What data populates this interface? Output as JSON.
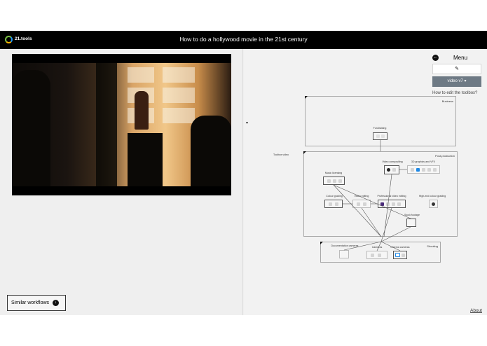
{
  "header": {
    "brand": "21.tools",
    "title": "How to do a hollywood movie in the 21st century"
  },
  "left": {
    "similar_label": "Similar workflows"
  },
  "menu": {
    "label": "Menu",
    "version_label": "video v7 ▾",
    "help_link": "How to edit the toolbox?"
  },
  "diagram": {
    "business_label": "Business",
    "fundraising_label": "Fundraising",
    "toolbox_label": "Toolbox video",
    "postproduction_label": "Post-production",
    "shooting_label": "Shooting",
    "tools": {
      "music_licensing": "Music licensing",
      "video_compositing": "Video compositing",
      "graphics_vfx": "3D graphics and VFX",
      "colour_grading": "Colour grading",
      "video_editing": "Video editing",
      "pro_video_editing": "Professional video editing",
      "high_end_grading": "High-end colour grading",
      "stock_footage": "Stock footage",
      "doc_cameras": "Documentation cameras",
      "cameras": "Cameras",
      "cinema_cameras": "Cinema cameras"
    }
  },
  "footer": {
    "about": "About"
  },
  "icons": {
    "back": "arrow-left-icon",
    "edit": "edit-icon",
    "similar": "arrow-down-icon",
    "logo": "ring-logo-icon"
  }
}
